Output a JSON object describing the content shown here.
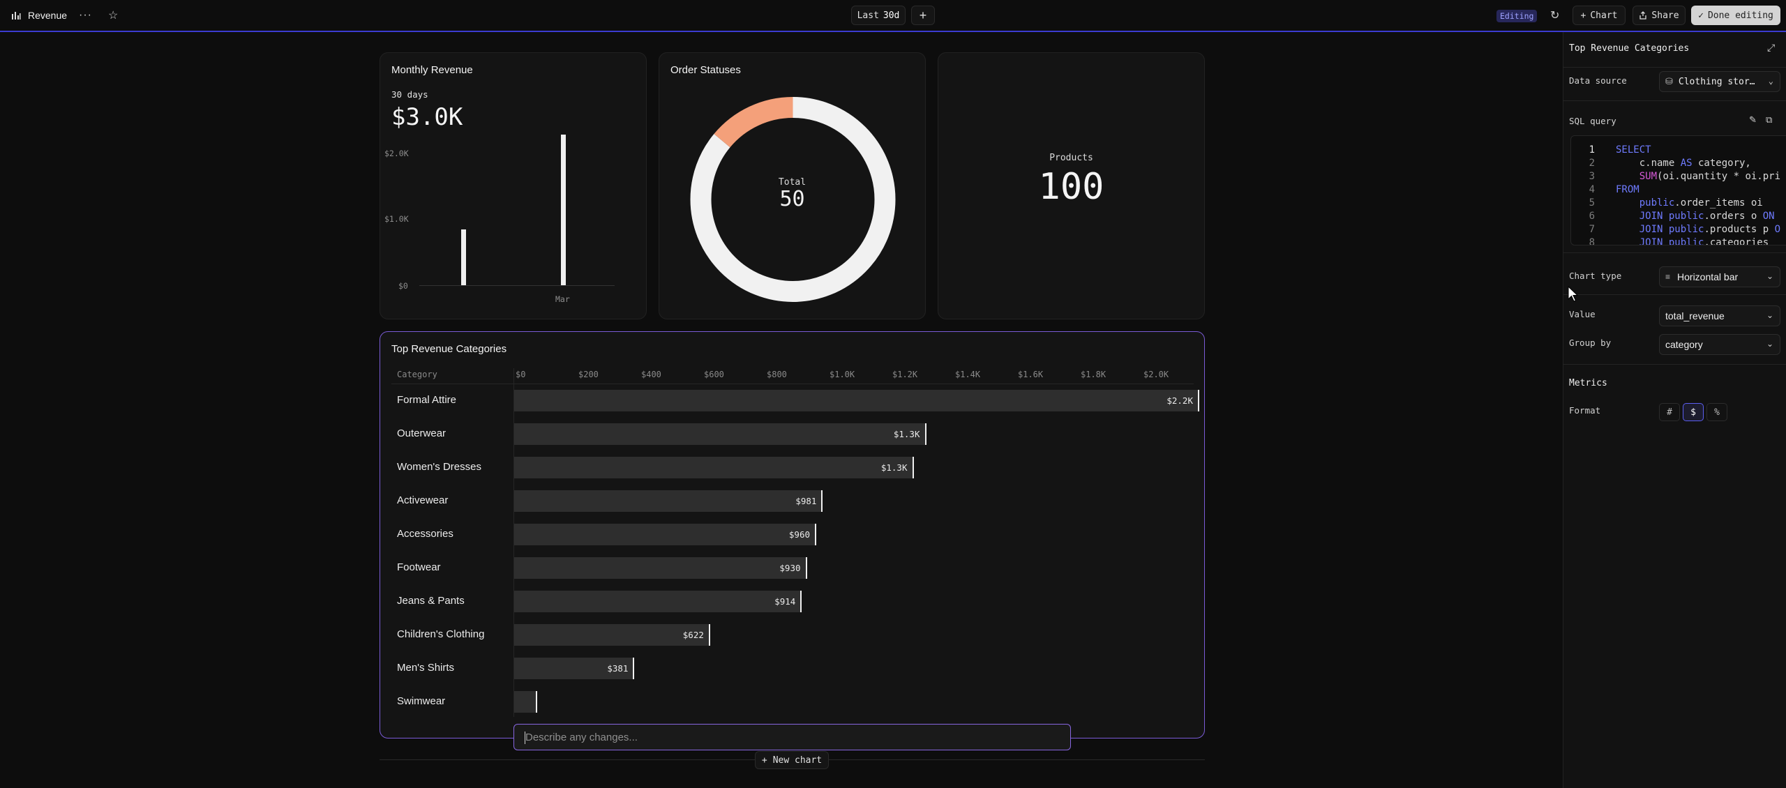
{
  "topbar": {
    "title": "Revenue",
    "range_prefix": "Last",
    "range_value": "30d",
    "editing_badge": "Editing",
    "chart_btn": "Chart",
    "share_btn": "Share",
    "done_btn": "Done editing"
  },
  "monthly_revenue": {
    "title": "Monthly Revenue",
    "period": "30 days",
    "total": "$3.0K",
    "y_ticks": [
      "$2.0K",
      "$1.0K",
      "$0"
    ],
    "x_label": "Mar",
    "bars": [
      0.85,
      2.3
    ]
  },
  "order_statuses": {
    "title": "Order Statuses",
    "total_label": "Total",
    "total": "50",
    "segments": [
      {
        "fraction": 0.86,
        "color": "#f1f1f1"
      },
      {
        "fraction": 0.14,
        "color": "#f4a07a"
      }
    ]
  },
  "products": {
    "label": "Products",
    "value": "100"
  },
  "top_revenue": {
    "title": "Top Revenue Categories",
    "category_header": "Category",
    "x_ticks": [
      "$0",
      "$200",
      "$400",
      "$600",
      "$800",
      "$1.0K",
      "$1.2K",
      "$1.4K",
      "$1.6K",
      "$1.8K",
      "$2.0K"
    ],
    "x_max": 2200,
    "rows": [
      {
        "label": "Formal Attire",
        "value": 2180,
        "display": "$2.2K"
      },
      {
        "label": "Outerwear",
        "value": 1310,
        "display": "$1.3K"
      },
      {
        "label": "Women's Dresses",
        "value": 1270,
        "display": "$1.3K"
      },
      {
        "label": "Activewear",
        "value": 981,
        "display": "$981"
      },
      {
        "label": "Accessories",
        "value": 960,
        "display": "$960"
      },
      {
        "label": "Footwear",
        "value": 930,
        "display": "$930"
      },
      {
        "label": "Jeans & Pants",
        "value": 914,
        "display": "$914"
      },
      {
        "label": "Children's Clothing",
        "value": 622,
        "display": "$622"
      },
      {
        "label": "Men's Shirts",
        "value": 381,
        "display": "$381"
      },
      {
        "label": "Swimwear",
        "value": 70,
        "display": ""
      }
    ]
  },
  "prompt": {
    "placeholder": "Describe any changes..."
  },
  "new_chart": "New chart",
  "panel": {
    "title": "Top Revenue Categories",
    "data_source_label": "Data source",
    "data_source_value": "Clothing stor…",
    "sql_label": "SQL query",
    "sql_lines": [
      {
        "n": "1",
        "parts": [
          [
            "kw",
            "SELECT"
          ]
        ]
      },
      {
        "n": "2",
        "parts": [
          [
            "",
            "    c.name "
          ],
          [
            "kw",
            "AS"
          ],
          [
            "",
            " category,"
          ]
        ]
      },
      {
        "n": "3",
        "parts": [
          [
            "",
            "    "
          ],
          [
            "fn",
            "SUM"
          ],
          [
            "",
            "(oi.quantity * oi.pri"
          ]
        ]
      },
      {
        "n": "4",
        "parts": [
          [
            "kw",
            "FROM"
          ]
        ]
      },
      {
        "n": "5",
        "parts": [
          [
            "",
            "    "
          ],
          [
            "kw",
            "public"
          ],
          [
            "",
            ".order_items oi"
          ]
        ]
      },
      {
        "n": "6",
        "parts": [
          [
            "",
            "    "
          ],
          [
            "kw",
            "JOIN public"
          ],
          [
            "",
            ".orders o "
          ],
          [
            "kw",
            "ON"
          ]
        ]
      },
      {
        "n": "7",
        "parts": [
          [
            "",
            "    "
          ],
          [
            "kw",
            "JOIN public"
          ],
          [
            "",
            ".products p "
          ],
          [
            "kw",
            "O"
          ]
        ]
      },
      {
        "n": "8",
        "parts": [
          [
            "",
            "    "
          ],
          [
            "kw",
            "JOIN public"
          ],
          [
            "",
            ".categories"
          ]
        ]
      }
    ],
    "chart_type_label": "Chart type",
    "chart_type_value": "Horizontal bar",
    "value_label": "Value",
    "value_value": "total_revenue",
    "group_by_label": "Group by",
    "group_by_value": "category",
    "metrics_title": "Metrics",
    "format_label": "Format",
    "format_options": [
      "#",
      "$",
      "%"
    ],
    "format_selected": "$"
  }
}
